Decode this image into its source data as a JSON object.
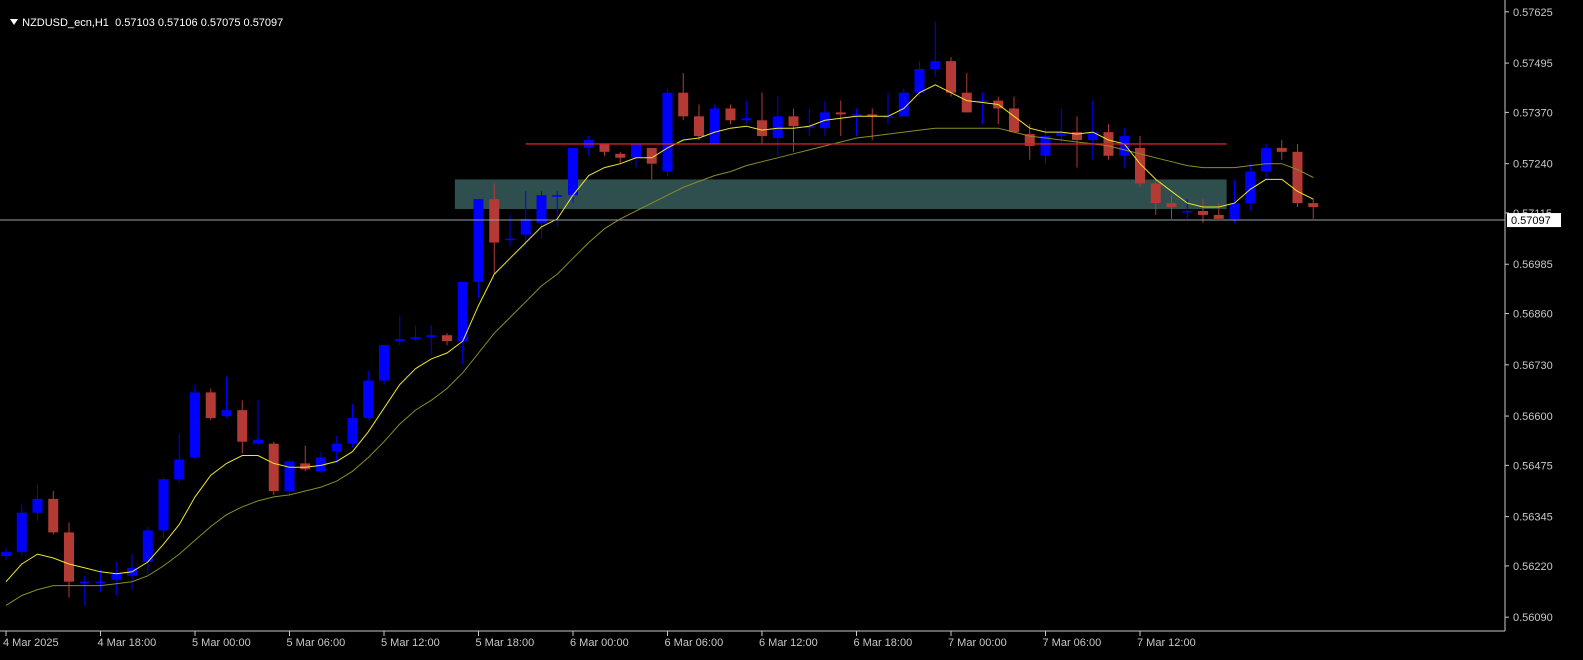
{
  "header": {
    "symbol": "NZDUSD_ecn,H1",
    "ohlc": "0.57103 0.57106 0.57075 0.57097"
  },
  "colors": {
    "background": "#000000",
    "bull": "#0000ff",
    "bear": "#b33a35",
    "ma_fast": "#f0e62a",
    "ma_slow": "#8c8c2a",
    "zone": "#2f4f4f",
    "resistance": "#d02020",
    "price_line": "#9aa0a6",
    "axis": "#c8c8c8"
  },
  "chart_data": {
    "type": "candlestick",
    "title": "NZDUSD_ecn,H1",
    "current_price": 0.57097,
    "current_price_label": "0.57097",
    "ylim": [
      0.56055,
      0.57655
    ],
    "y_ticks": [
      "0.57625",
      "0.57495",
      "0.57370",
      "0.57240",
      "0.57115",
      "0.56985",
      "0.56860",
      "0.56730",
      "0.56600",
      "0.56475",
      "0.56345",
      "0.56220",
      "0.56090"
    ],
    "x_ticks": [
      {
        "label": "4 Mar 2025",
        "index": 0
      },
      {
        "label": "4 Mar 18:00",
        "index": 6
      },
      {
        "label": "5 Mar 00:00",
        "index": 12
      },
      {
        "label": "5 Mar 06:00",
        "index": 18
      },
      {
        "label": "5 Mar 12:00",
        "index": 24
      },
      {
        "label": "5 Mar 18:00",
        "index": 30
      },
      {
        "label": "6 Mar 00:00",
        "index": 36
      },
      {
        "label": "6 Mar 06:00",
        "index": 42
      },
      {
        "label": "6 Mar 12:00",
        "index": 48
      },
      {
        "label": "6 Mar 18:00",
        "index": 54
      },
      {
        "label": "7 Mar 00:00",
        "index": 60
      },
      {
        "label": "7 Mar 06:00",
        "index": 66
      },
      {
        "label": "7 Mar 12:00",
        "index": 72
      }
    ],
    "candles": [
      [
        0.56245,
        0.56265,
        0.56235,
        0.56255
      ],
      [
        0.56255,
        0.56375,
        0.56245,
        0.56355
      ],
      [
        0.56355,
        0.56425,
        0.56335,
        0.5639
      ],
      [
        0.5639,
        0.5641,
        0.563,
        0.56305
      ],
      [
        0.56305,
        0.5633,
        0.5614,
        0.5618
      ],
      [
        0.5618,
        0.56195,
        0.5612,
        0.5618
      ],
      [
        0.5618,
        0.5621,
        0.56155,
        0.5618
      ],
      [
        0.56185,
        0.5623,
        0.56145,
        0.562
      ],
      [
        0.56195,
        0.5625,
        0.5616,
        0.56215
      ],
      [
        0.5623,
        0.5632,
        0.562,
        0.5631
      ],
      [
        0.5631,
        0.56445,
        0.5629,
        0.5644
      ],
      [
        0.5644,
        0.56555,
        0.5643,
        0.5649
      ],
      [
        0.56495,
        0.5668,
        0.5649,
        0.5666
      ],
      [
        0.5666,
        0.5667,
        0.5659,
        0.56595
      ],
      [
        0.566,
        0.567,
        0.56595,
        0.56615
      ],
      [
        0.56615,
        0.5664,
        0.56505,
        0.56535
      ],
      [
        0.5653,
        0.5664,
        0.56525,
        0.5654
      ],
      [
        0.5653,
        0.56535,
        0.564,
        0.5641
      ],
      [
        0.5641,
        0.5649,
        0.56395,
        0.56485
      ],
      [
        0.5648,
        0.56525,
        0.5646,
        0.56465
      ],
      [
        0.5646,
        0.5651,
        0.56455,
        0.56495
      ],
      [
        0.5651,
        0.5655,
        0.5648,
        0.5653
      ],
      [
        0.5653,
        0.5663,
        0.5652,
        0.56595
      ],
      [
        0.56595,
        0.56715,
        0.5659,
        0.5669
      ],
      [
        0.5669,
        0.5678,
        0.5668,
        0.5678
      ],
      [
        0.5679,
        0.56855,
        0.5678,
        0.56795
      ],
      [
        0.56795,
        0.5683,
        0.5679,
        0.568
      ],
      [
        0.568,
        0.5683,
        0.5676,
        0.56805
      ],
      [
        0.56805,
        0.5681,
        0.5678,
        0.5679
      ],
      [
        0.5679,
        0.5688,
        0.5673,
        0.5694
      ],
      [
        0.5694,
        0.5697,
        0.569,
        0.5715
      ],
      [
        0.5715,
        0.5719,
        0.5696,
        0.5704
      ],
      [
        0.5705,
        0.5711,
        0.5703,
        0.5705
      ],
      [
        0.5706,
        0.5717,
        0.5703,
        0.571
      ],
      [
        0.5709,
        0.5717,
        0.5705,
        0.5716
      ],
      [
        0.5716,
        0.5717,
        0.5708,
        0.5716
      ],
      [
        0.5716,
        0.5725,
        0.5714,
        0.5728
      ],
      [
        0.5728,
        0.5731,
        0.5726,
        0.573
      ],
      [
        0.5729,
        0.5729,
        0.5726,
        0.5727
      ],
      [
        0.57265,
        0.5727,
        0.5724,
        0.57255
      ],
      [
        0.57255,
        0.5729,
        0.5723,
        0.5729
      ],
      [
        0.5728,
        0.5728,
        0.572,
        0.5724
      ],
      [
        0.5722,
        0.5743,
        0.5721,
        0.5742
      ],
      [
        0.5742,
        0.5747,
        0.5735,
        0.5736
      ],
      [
        0.5736,
        0.5739,
        0.573,
        0.5731
      ],
      [
        0.5729,
        0.5739,
        0.5729,
        0.5738
      ],
      [
        0.5738,
        0.5739,
        0.5734,
        0.5735
      ],
      [
        0.5735,
        0.574,
        0.5734,
        0.57355
      ],
      [
        0.5735,
        0.5742,
        0.5729,
        0.5731
      ],
      [
        0.57305,
        0.5741,
        0.5726,
        0.5736
      ],
      [
        0.5736,
        0.5738,
        0.5727,
        0.57335
      ],
      [
        0.5733,
        0.5738,
        0.5731,
        0.57335
      ],
      [
        0.5733,
        0.574,
        0.5731,
        0.5737
      ],
      [
        0.5737,
        0.574,
        0.5731,
        0.57365
      ],
      [
        0.5736,
        0.5738,
        0.5731,
        0.57365
      ],
      [
        0.57365,
        0.5738,
        0.573,
        0.5736
      ],
      [
        0.5736,
        0.5742,
        0.5734,
        0.5736
      ],
      [
        0.5736,
        0.5743,
        0.5736,
        0.5742
      ],
      [
        0.5742,
        0.575,
        0.5741,
        0.5748
      ],
      [
        0.5748,
        0.576,
        0.5746,
        0.575
      ],
      [
        0.575,
        0.5751,
        0.5741,
        0.5742
      ],
      [
        0.5742,
        0.5747,
        0.5737,
        0.5737
      ],
      [
        0.574,
        0.5742,
        0.5734,
        0.574
      ],
      [
        0.574,
        0.5741,
        0.5734,
        0.5738
      ],
      [
        0.5738,
        0.5741,
        0.5732,
        0.5732
      ],
      [
        0.57315,
        0.5734,
        0.5725,
        0.57285
      ],
      [
        0.5726,
        0.5733,
        0.5724,
        0.5731
      ],
      [
        0.5731,
        0.5738,
        0.5729,
        0.5732
      ],
      [
        0.5732,
        0.5736,
        0.5723,
        0.573
      ],
      [
        0.573,
        0.574,
        0.5725,
        0.5732
      ],
      [
        0.5732,
        0.5734,
        0.5725,
        0.5726
      ],
      [
        0.5726,
        0.5733,
        0.5723,
        0.5731
      ],
      [
        0.5728,
        0.5731,
        0.5718,
        0.5719
      ],
      [
        0.5719,
        0.572,
        0.5711,
        0.5714
      ],
      [
        0.5714,
        0.5716,
        0.571,
        0.5713
      ],
      [
        0.5712,
        0.5715,
        0.571,
        0.5712
      ],
      [
        0.5712,
        0.5715,
        0.5709,
        0.5711
      ],
      [
        0.5711,
        0.5714,
        0.571,
        0.571
      ],
      [
        0.571,
        0.572,
        0.5709,
        0.5714
      ],
      [
        0.5714,
        0.5724,
        0.5712,
        0.5722
      ],
      [
        0.5722,
        0.5729,
        0.572,
        0.5728
      ],
      [
        0.5728,
        0.573,
        0.5725,
        0.5727
      ],
      [
        0.5727,
        0.5729,
        0.5713,
        0.5714
      ],
      [
        0.5714,
        0.5715,
        0.571,
        0.5713
      ]
    ],
    "ma_fast": [
      0.5618,
      0.56225,
      0.5625,
      0.5624,
      0.56225,
      0.56215,
      0.56205,
      0.562,
      0.56205,
      0.5623,
      0.56275,
      0.56325,
      0.56395,
      0.5645,
      0.5648,
      0.565,
      0.565,
      0.5648,
      0.5647,
      0.5647,
      0.56475,
      0.56485,
      0.5651,
      0.5656,
      0.5662,
      0.5668,
      0.5672,
      0.56745,
      0.5676,
      0.5679,
      0.5688,
      0.5696,
      0.57,
      0.5704,
      0.5708,
      0.571,
      0.5716,
      0.5721,
      0.5723,
      0.5724,
      0.57255,
      0.57255,
      0.5728,
      0.573,
      0.57305,
      0.5732,
      0.5733,
      0.57335,
      0.57325,
      0.5733,
      0.5733,
      0.57335,
      0.5735,
      0.57355,
      0.5736,
      0.5736,
      0.5736,
      0.5738,
      0.5742,
      0.5744,
      0.5742,
      0.574,
      0.57395,
      0.5739,
      0.5736,
      0.5733,
      0.5732,
      0.5732,
      0.57315,
      0.5732,
      0.573,
      0.5729,
      0.5724,
      0.572,
      0.5717,
      0.5714,
      0.5713,
      0.5713,
      0.5714,
      0.57175,
      0.572,
      0.572,
      0.5717,
      0.5715
    ],
    "ma_slow": [
      0.5612,
      0.56145,
      0.5616,
      0.5617,
      0.5617,
      0.5617,
      0.5617,
      0.56175,
      0.5618,
      0.56195,
      0.5622,
      0.5625,
      0.56285,
      0.5632,
      0.5635,
      0.5637,
      0.56385,
      0.56395,
      0.564,
      0.5641,
      0.5642,
      0.56435,
      0.5646,
      0.56495,
      0.56535,
      0.5658,
      0.56615,
      0.5664,
      0.5667,
      0.5671,
      0.5676,
      0.5681,
      0.5685,
      0.5689,
      0.5693,
      0.5696,
      0.57,
      0.5704,
      0.57075,
      0.571,
      0.5712,
      0.5714,
      0.5716,
      0.5718,
      0.57195,
      0.5721,
      0.5722,
      0.57235,
      0.57245,
      0.57255,
      0.57265,
      0.57275,
      0.57285,
      0.57295,
      0.57305,
      0.5731,
      0.57315,
      0.5732,
      0.57325,
      0.5733,
      0.5733,
      0.5733,
      0.5733,
      0.5733,
      0.5732,
      0.5731,
      0.57305,
      0.573,
      0.57295,
      0.5729,
      0.57285,
      0.57275,
      0.57265,
      0.57255,
      0.57245,
      0.57235,
      0.5723,
      0.5723,
      0.5723,
      0.57235,
      0.5724,
      0.5724,
      0.57225,
      0.57205
    ],
    "zone": {
      "top": 0.572,
      "bottom": 0.57125,
      "from_index": 28.5,
      "to_index": 77.5
    },
    "resistance_line": {
      "price": 0.5729,
      "from_index": 33,
      "to_index": 77.5
    }
  }
}
